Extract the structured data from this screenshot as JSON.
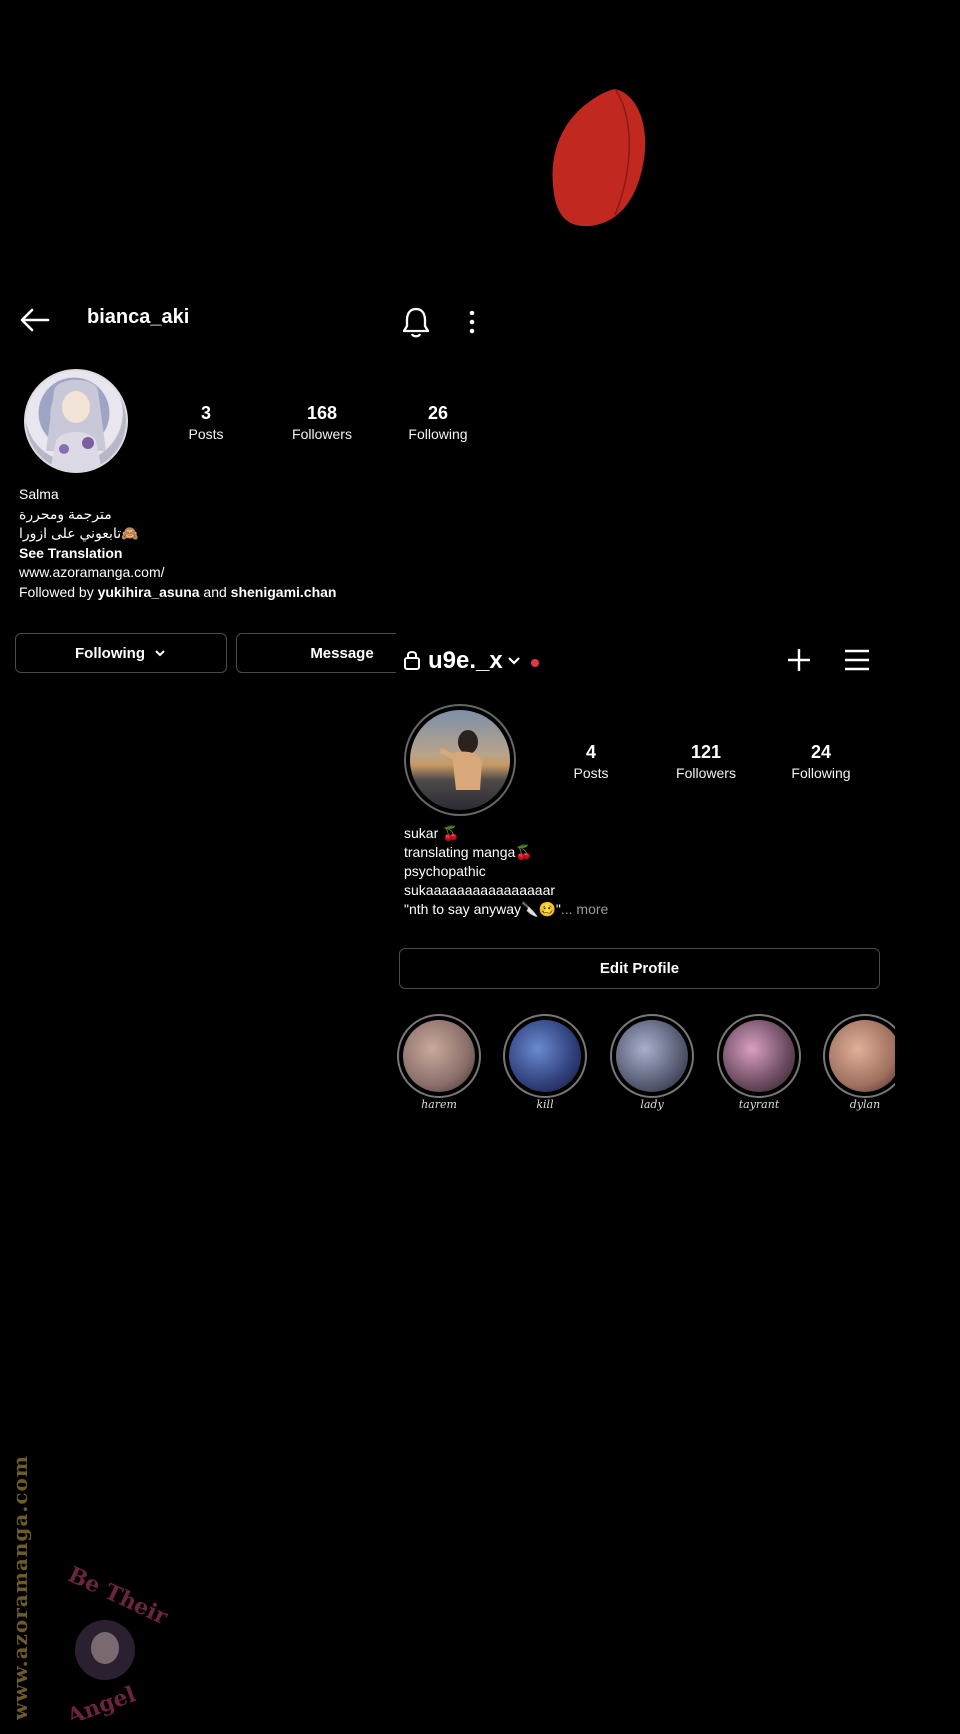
{
  "profile_one": {
    "username": "bianca_aki",
    "stats": [
      {
        "count": "3",
        "label": "Posts"
      },
      {
        "count": "168",
        "label": "Followers"
      },
      {
        "count": "26",
        "label": "Following"
      }
    ],
    "name": "Salma",
    "bio_line1": "مترجمة ومحررة",
    "bio_line2": "تابعوني على ازورا🙈",
    "see_translation": "See Translation",
    "website": "www.azoramanga.com/",
    "followed_by_prefix": "Followed by ",
    "followed_by_user1": "yukihira_asuna",
    "followed_by_and": " and ",
    "followed_by_user2": "shenigami.chan",
    "following_button": "Following",
    "message_button": "Message"
  },
  "profile_two": {
    "username": "u9e._x",
    "stats": [
      {
        "count": "4",
        "label": "Posts"
      },
      {
        "count": "121",
        "label": "Followers"
      },
      {
        "count": "24",
        "label": "Following"
      }
    ],
    "bio": [
      "sukar 🍒",
      "translating manga🍒",
      "psychopathic",
      "sukaaaaaaaaaaaaaaaar"
    ],
    "bio_last": "\"nth to say anyway🔪🥴\"",
    "more_label": "... more",
    "edit_profile_button": "Edit Profile",
    "highlights": [
      {
        "label": "harem",
        "color": "#8a6f6a"
      },
      {
        "label": "kill",
        "color": "#2f3f7a"
      },
      {
        "label": "lady",
        "color": "#565b73"
      },
      {
        "label": "tayrant",
        "color": "#6a4a5e"
      },
      {
        "label": "dylan",
        "color": "#a07060"
      }
    ]
  },
  "watermark": {
    "site": "www.azoramanga.com",
    "logo_text": "Be Their Angel"
  },
  "colors": {
    "background": "#000000",
    "accent_dot": "#e0394d",
    "petal": "#c02820"
  }
}
